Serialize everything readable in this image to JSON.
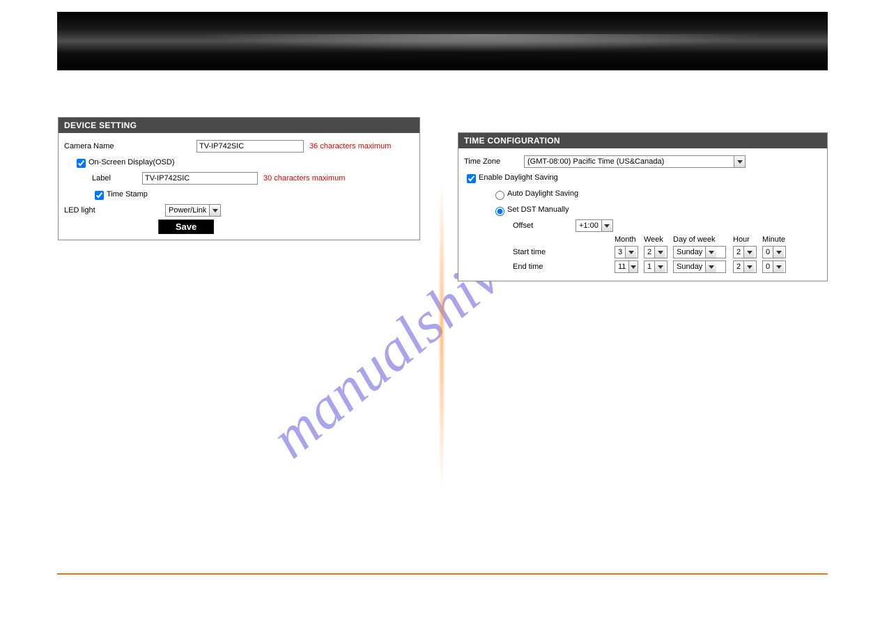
{
  "watermark": "manualshive.com",
  "device_setting": {
    "title": "DEVICE SETTING",
    "camera_name_label": "Camera Name",
    "camera_name_value": "TV-IP742SIC",
    "camera_name_hint": "36 characters maximum",
    "osd_label": "On-Screen Display(OSD)",
    "osd_checked": true,
    "label_label": "Label",
    "label_value": "TV-IP742SIC",
    "label_hint": "30 characters maximum",
    "timestamp_label": "Time Stamp",
    "timestamp_checked": true,
    "led_label": "LED light",
    "led_value": "Power/Link",
    "save_label": "Save"
  },
  "time_config": {
    "title": "TIME CONFIGURATION",
    "tz_label": "Time Zone",
    "tz_value": "(GMT-08:00) Pacific Time (US&Canada)",
    "enable_dst_label": "Enable Daylight Saving",
    "enable_dst_checked": true,
    "auto_dst_label": "Auto Daylight Saving",
    "manual_dst_label": "Set DST Manually",
    "dst_mode": "manual",
    "offset_label": "Offset",
    "offset_value": "+1:00",
    "headers": {
      "month": "Month",
      "week": "Week",
      "dow": "Day of week",
      "hour": "Hour",
      "minute": "Minute"
    },
    "start": {
      "label": "Start time",
      "month": "3",
      "week": "2",
      "dow": "Sunday",
      "hour": "2",
      "minute": "0"
    },
    "end": {
      "label": "End time",
      "month": "11",
      "week": "1",
      "dow": "Sunday",
      "hour": "2",
      "minute": "0"
    }
  }
}
